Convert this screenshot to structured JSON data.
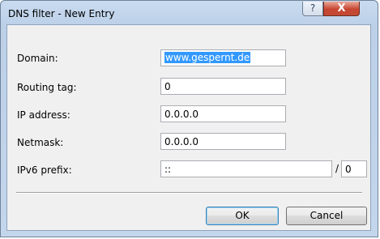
{
  "window": {
    "title": "DNS filter - New Entry",
    "help_glyph": "?",
    "close_glyph": "X"
  },
  "form": {
    "domain_label": "Domain:",
    "domain_value": "www.gespernt.de",
    "routing_tag_label": "Routing tag:",
    "routing_tag_value": "0",
    "ip_address_label": "IP address:",
    "ip_address_value": "0.0.0.0",
    "netmask_label": "Netmask:",
    "netmask_value": "0.0.0.0",
    "ipv6_prefix_label": "IPv6 prefix:",
    "ipv6_prefix_value": "::",
    "prefix_separator": "/",
    "prefix_length_value": "0"
  },
  "buttons": {
    "ok_label": "OK",
    "cancel_label": "Cancel"
  }
}
